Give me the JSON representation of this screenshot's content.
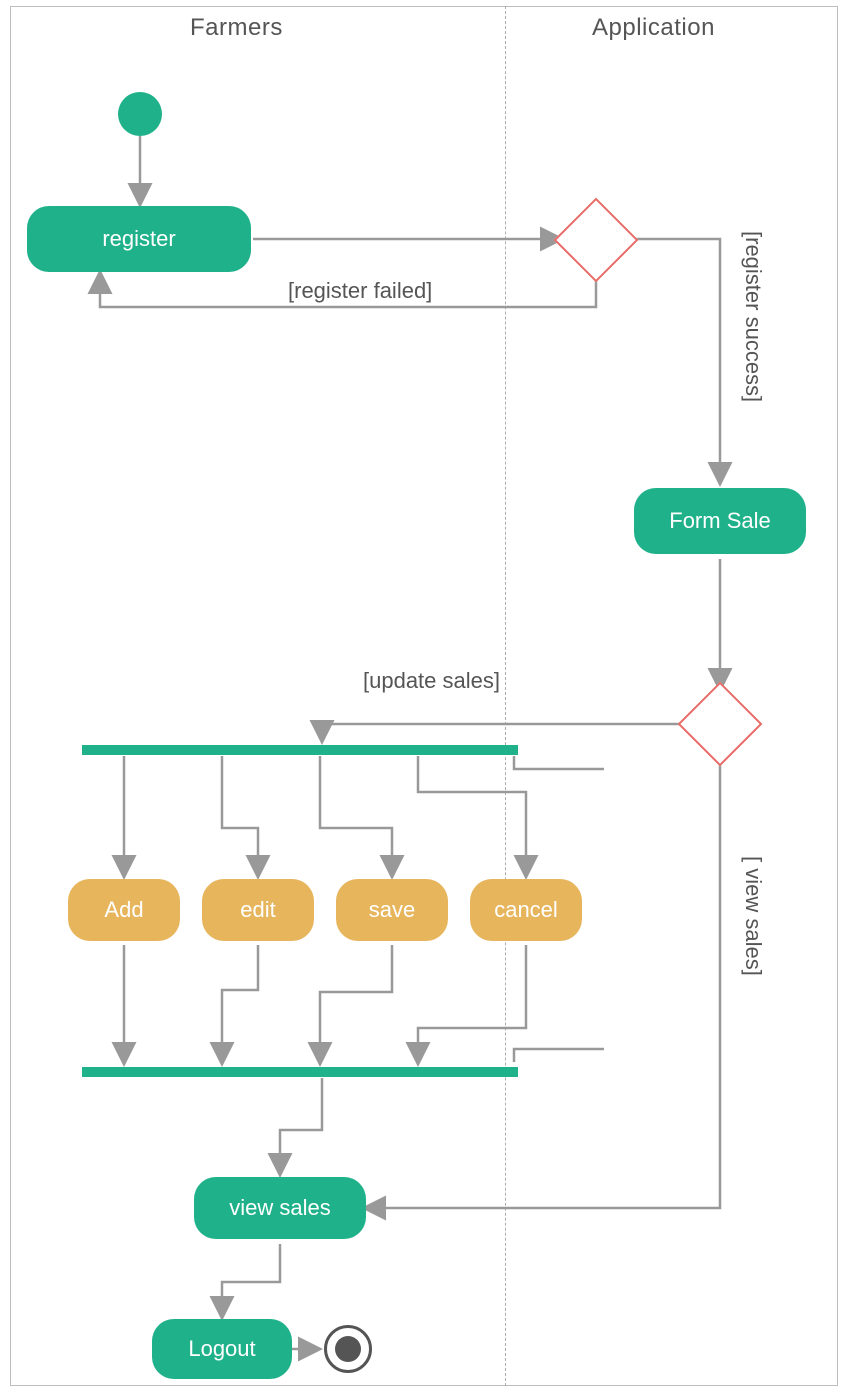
{
  "swimlanes": {
    "left": "Farmers",
    "right": "Application"
  },
  "nodes": {
    "register": "register",
    "form_sale": "Form Sale",
    "add": "Add",
    "edit": "edit",
    "save": "save",
    "cancel": "cancel",
    "view_sales": "view sales",
    "logout": "Logout"
  },
  "guards": {
    "register_failed": "[register failed]",
    "register_success": "[register success]",
    "update_sales": "[update sales]",
    "view_sales": "[ view sales]"
  },
  "colors": {
    "activity_green": "#1fb28a",
    "activity_orange": "#e7b55c",
    "decision_border": "#e86b66",
    "edge": "#999999"
  }
}
